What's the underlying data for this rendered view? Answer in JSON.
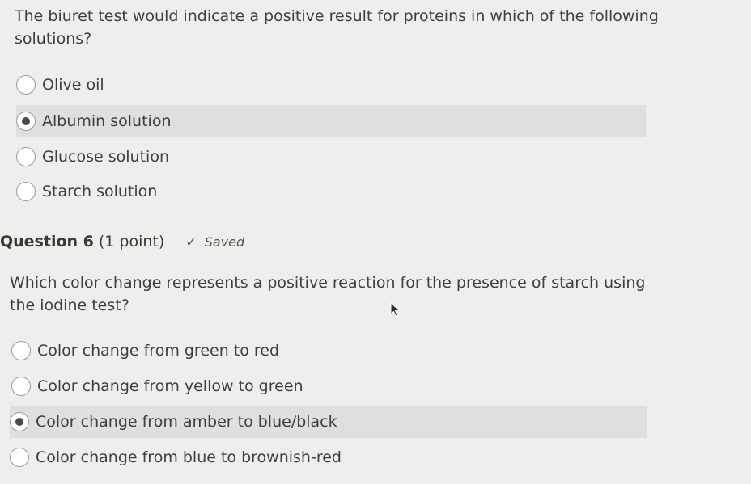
{
  "question5": {
    "text": "The biuret test would indicate a positive result for proteins in which of the following solutions?",
    "options": [
      {
        "label": "Olive oil",
        "selected": false
      },
      {
        "label": "Albumin solution",
        "selected": true
      },
      {
        "label": "Glucose solution",
        "selected": false
      },
      {
        "label": "Starch solution",
        "selected": false
      }
    ]
  },
  "question6": {
    "number": "Question 6",
    "points": "(1 point)",
    "saved": "Saved",
    "text": "Which color change represents a positive reaction for the presence of starch using the iodine test?",
    "options": [
      {
        "label": "Color change from green to red",
        "selected": false
      },
      {
        "label": "Color change from yellow to green",
        "selected": false
      },
      {
        "label": "Color change from amber to blue/black",
        "selected": true
      },
      {
        "label": "Color change from blue to brownish-red",
        "selected": false
      }
    ]
  },
  "colors": {
    "background": "#efeeec",
    "selected_row": "#dfdfe1",
    "text": "#3f3e3c"
  },
  "icons": {
    "saved": "checkmark-icon",
    "cursor": "mouse-pointer-icon"
  }
}
